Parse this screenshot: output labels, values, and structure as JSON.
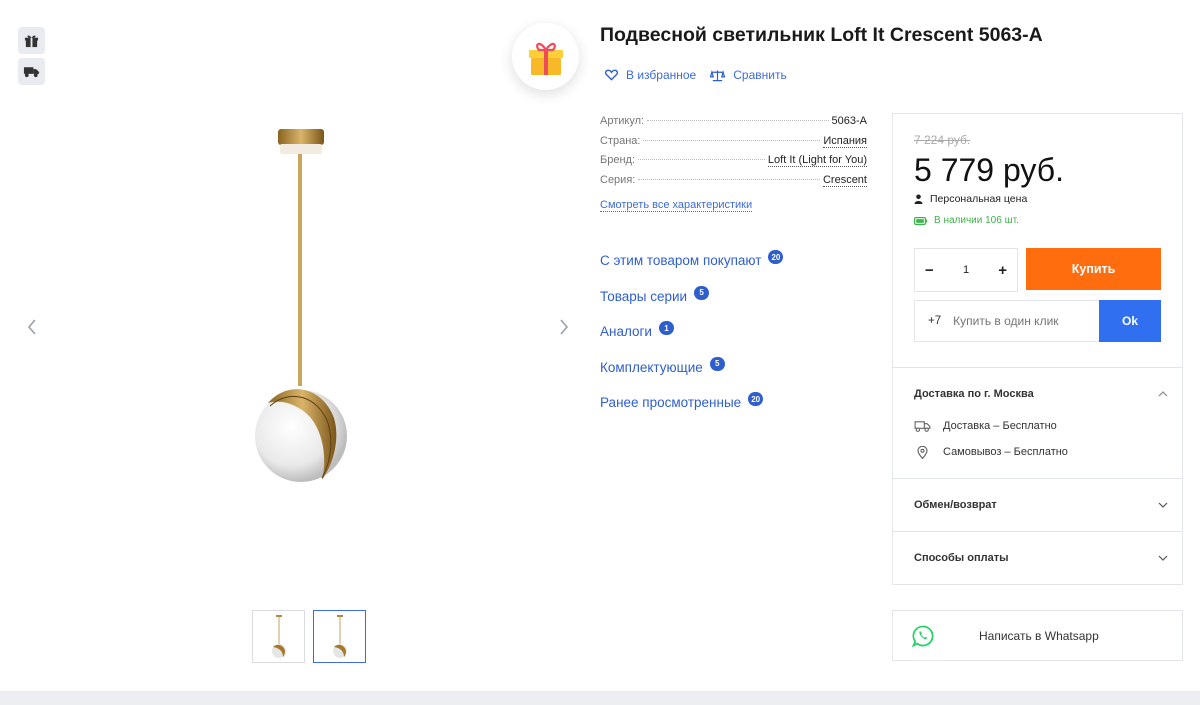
{
  "product": {
    "title": "Подвесной светильник Loft It Crescent 5063-A"
  },
  "actions": {
    "favorite": "В избранное",
    "compare": "Сравнить"
  },
  "specs": [
    {
      "key": "Артикул:",
      "value": "5063-A"
    },
    {
      "key": "Страна:",
      "value": "Испания"
    },
    {
      "key": "Бренд:",
      "value": "Loft It (Light for You)"
    },
    {
      "key": "Серия:",
      "value": "Crescent"
    }
  ],
  "all_specs_link": "Смотреть все характеристики",
  "related": [
    {
      "label": "С этим товаром покупают",
      "count": "20"
    },
    {
      "label": "Товары серии",
      "count": "5"
    },
    {
      "label": "Аналоги",
      "count": "1"
    },
    {
      "label": "Комплектующие",
      "count": "5"
    },
    {
      "label": "Ранее просмотренные",
      "count": "20"
    }
  ],
  "pricing": {
    "old_price": "7 224 руб.",
    "price": "5 779 руб.",
    "personal": "Персональная цена",
    "stock": "В наличии 106 шт."
  },
  "cart": {
    "minus": "−",
    "quantity": "1",
    "plus": "+",
    "buy_label": "Купить"
  },
  "oneclick": {
    "prefix": "+7",
    "placeholder": "Купить в один клик",
    "ok_label": "Ok"
  },
  "delivery": {
    "heading": "Доставка по г. Москва",
    "items": [
      "Доставка – Бесплатно",
      "Самовывоз – Бесплатно"
    ]
  },
  "exchange": {
    "heading": "Обмен/возврат"
  },
  "payment": {
    "heading": "Способы оплаты"
  },
  "whatsapp": {
    "label": "Написать в Whatsapp"
  },
  "colors": {
    "accent": "#2f5fcc",
    "buy": "#ff6d0e",
    "ok": "#2f6ff0",
    "stock": "#3cb34a",
    "whatsapp": "#25d366"
  }
}
